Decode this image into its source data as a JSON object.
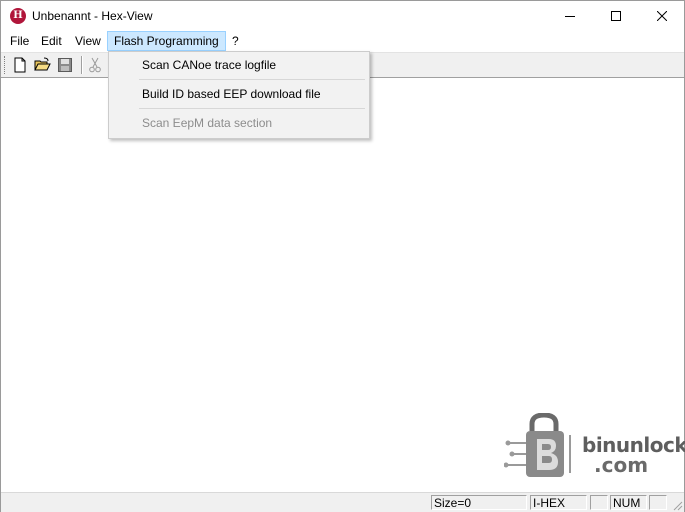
{
  "window": {
    "title": "Unbenannt - Hex-View",
    "icon_letter": "H"
  },
  "menubar": {
    "items": [
      {
        "label": "File"
      },
      {
        "label": "Edit"
      },
      {
        "label": "View"
      },
      {
        "label": "Flash Programming"
      },
      {
        "label": "?"
      }
    ],
    "active": "Flash Programming"
  },
  "toolbar": {
    "buttons": [
      "new-file-icon",
      "open-folder-icon",
      "save-icon",
      "cut-icon"
    ]
  },
  "dropdown": {
    "items": [
      {
        "label": "Scan CANoe trace logfile",
        "enabled": true
      },
      {
        "label": "Build ID based EEP download file",
        "enabled": true
      },
      {
        "label": "Scan EepM data section",
        "enabled": false
      }
    ]
  },
  "statusbar": {
    "size": "Size=0",
    "format": "I-HEX",
    "num": "NUM"
  },
  "watermark": {
    "line1": "binunlock",
    "line2": ".com"
  },
  "colors": {
    "menu_highlight": "#cce8ff",
    "menu_highlight_border": "#99d1ff",
    "app_icon": "#b0153a",
    "disabled_text": "#8d8d8d"
  }
}
